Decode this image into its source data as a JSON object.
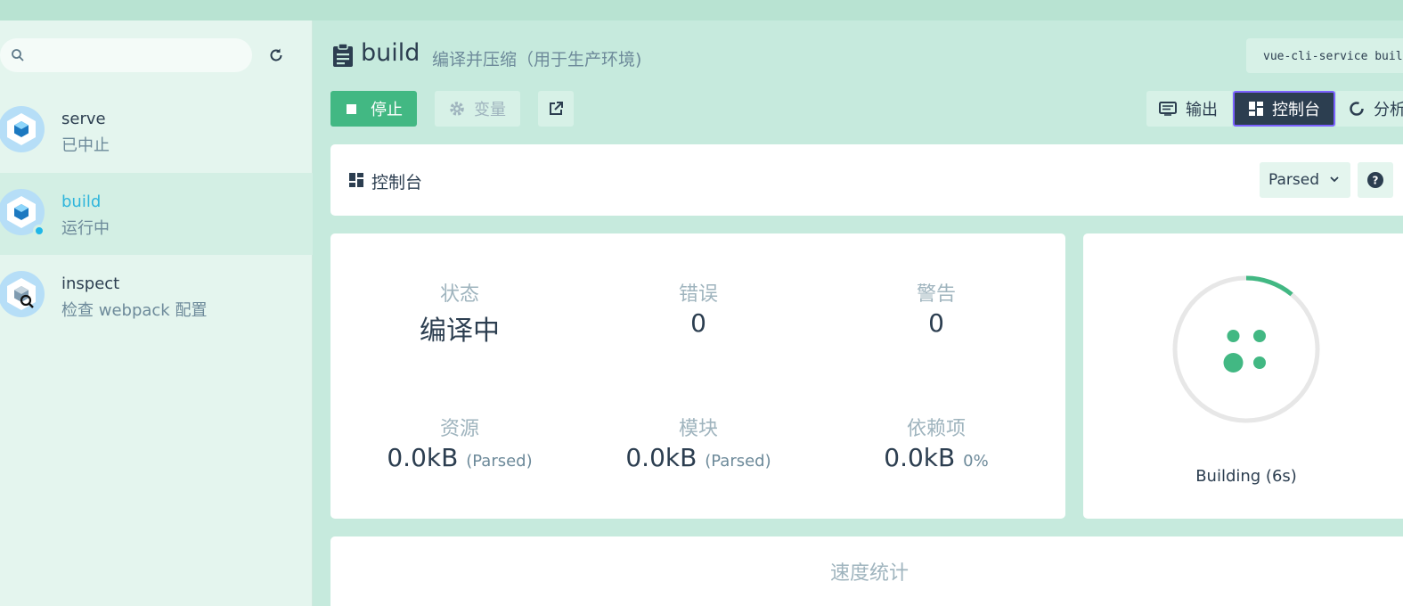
{
  "sidebar": {
    "search": {
      "placeholder": "",
      "value": ""
    },
    "tasks": [
      {
        "name": "serve",
        "description": "已中止",
        "status": "stopped"
      },
      {
        "name": "build",
        "description": "运行中",
        "status": "running"
      },
      {
        "name": "inspect",
        "description": "检查 webpack 配置",
        "status": "idle"
      }
    ]
  },
  "header": {
    "title": "build",
    "subtitle": "编译并压缩（用于生产环境)",
    "command": "vue-cli-service build"
  },
  "actions": {
    "stop_label": "停止",
    "variables_label": "变量",
    "views": [
      "输出",
      "控制台",
      "分析"
    ]
  },
  "panel": {
    "title": "控制台",
    "mode_selected": "Parsed"
  },
  "stats": {
    "status": {
      "label": "状态",
      "value": "编译中"
    },
    "errors": {
      "label": "错误",
      "value": "0"
    },
    "warnings": {
      "label": "警告",
      "value": "0"
    },
    "assets": {
      "label": "资源",
      "value": "0.0kB",
      "note": "(Parsed)"
    },
    "modules": {
      "label": "模块",
      "value": "0.0kB",
      "note": "(Parsed)"
    },
    "dependencies": {
      "label": "依赖项",
      "value": "0.0kB",
      "note": "0%"
    }
  },
  "progress": {
    "status_text": "Building (6s)",
    "fraction": 0.11
  },
  "speed": {
    "title": "速度统计"
  },
  "colors": {
    "accent": "#42b883",
    "dark": "#2c3e50",
    "info": "#1fb7e8",
    "focus_border": "#7b61ff"
  }
}
